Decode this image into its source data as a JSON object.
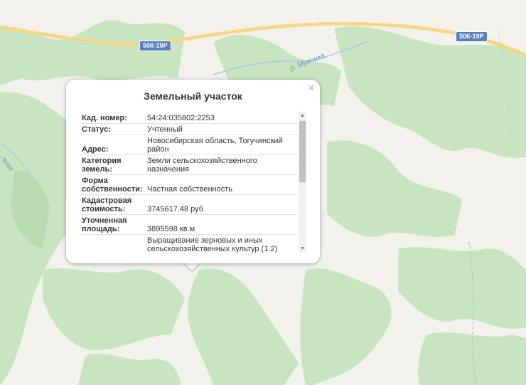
{
  "map": {
    "road_badges": [
      "50К-19Р",
      "50К-19Р"
    ],
    "river_label": "р. Мунчиха",
    "river_label_2": "...чиха",
    "colors": {
      "forest": "#c8e4c0",
      "open": "#f3f1ec",
      "road": "#f7d98a",
      "water": "#a9c8ec"
    }
  },
  "popup": {
    "title": "Земельный участок",
    "close_label": "×",
    "rows": [
      {
        "key": "Кад. номер",
        "value": "54:24:035802:2253"
      },
      {
        "key": "Статус",
        "value": "Учтенный"
      },
      {
        "key": "Адрес",
        "value": "Новосибирская область, Тогучинский район"
      },
      {
        "key": "Категория земель",
        "value": "Земли сельскохозяйственного назначения"
      },
      {
        "key": "Форма собственности",
        "value": "Частная собственность"
      },
      {
        "key": "Кадастровая стоимость",
        "value": "3745617.48 руб"
      },
      {
        "key": "Уточненная площадь",
        "value": "3895598 кв.м"
      },
      {
        "key": "",
        "value": "Выращивание зерновых и иных сельскохозяйственных культур (1.2)"
      }
    ],
    "colon": ":"
  }
}
